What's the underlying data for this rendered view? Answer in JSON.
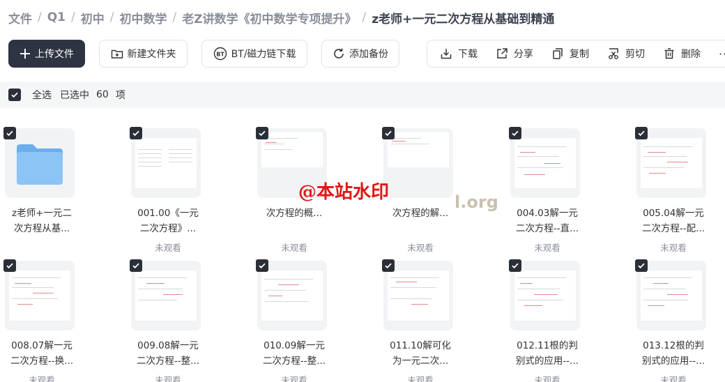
{
  "breadcrumb": [
    {
      "label": "文件"
    },
    {
      "label": "Q1"
    },
    {
      "label": "初中"
    },
    {
      "label": "初中数学"
    },
    {
      "label": "老Z讲数学《初中数学专项提升》"
    },
    {
      "label": "z老师+一元二次方程从基础到精通"
    }
  ],
  "toolbar": {
    "upload": "上传文件",
    "new_folder": "新建文件夹",
    "bt_download": "BT/磁力链下载",
    "add_backup": "添加备份",
    "download": "下载",
    "share": "分享",
    "copy": "复制",
    "cut": "剪切",
    "delete": "删除",
    "more": "···"
  },
  "selection": {
    "select_all": "全选",
    "selected_prefix": "已选中",
    "count": "60",
    "unit": "项"
  },
  "files": [
    {
      "type": "folder",
      "name_l1": "z老师+一元二",
      "name_l2": "次方程从基...",
      "sub": ""
    },
    {
      "type": "doc",
      "name_l1": "001.00《一元",
      "name_l2": "二次方程》...",
      "sub": "未观看"
    },
    {
      "type": "doc",
      "name_l1": "",
      "name_l2": "次方程的概...",
      "sub": "未观看"
    },
    {
      "type": "doc",
      "name_l1": "",
      "name_l2": "次方程的解...",
      "sub": "未观看"
    },
    {
      "type": "doc",
      "name_l1": "004.03解一元",
      "name_l2": "二次方程--直...",
      "sub": "未观看"
    },
    {
      "type": "doc",
      "name_l1": "005.04解一元",
      "name_l2": "二次方程--配...",
      "sub": "未观看"
    },
    {
      "type": "doc",
      "name_l1": "008.07解一元",
      "name_l2": "二次方程--换...",
      "sub": "未观看"
    },
    {
      "type": "doc",
      "name_l1": "009.08解一元",
      "name_l2": "二次方程--整...",
      "sub": "未观看"
    },
    {
      "type": "doc",
      "name_l1": "010.09解一元",
      "name_l2": "二次方程--整...",
      "sub": "未观看"
    },
    {
      "type": "doc",
      "name_l1": "011.10解可化",
      "name_l2": "为一元二次...",
      "sub": "未观看"
    },
    {
      "type": "doc",
      "name_l1": "012.11根的判",
      "name_l2": "别式的应用--...",
      "sub": "未观看"
    },
    {
      "type": "doc",
      "name_l1": "013.12根的判",
      "name_l2": "别式的应用--...",
      "sub": "未观看"
    }
  ],
  "watermark": {
    "text": "@本站水印",
    "text2": "l.org"
  },
  "colors": {
    "primary_btn": "#2f3442",
    "checkbox": "#2b2f38",
    "folder": "#7db9f0",
    "watermark": "#e21414"
  }
}
